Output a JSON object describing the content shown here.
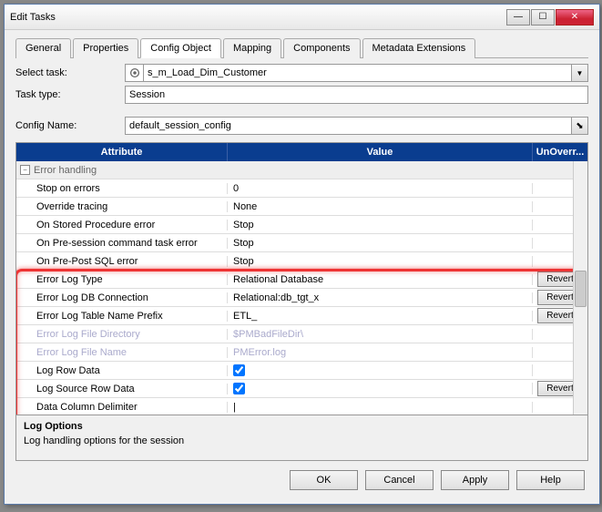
{
  "window": {
    "title": "Edit Tasks"
  },
  "tabs": [
    "General",
    "Properties",
    "Config Object",
    "Mapping",
    "Components",
    "Metadata Extensions"
  ],
  "activeTab": 2,
  "form": {
    "selectTaskLabel": "Select task:",
    "selectTaskValue": "s_m_Load_Dim_Customer",
    "taskTypeLabel": "Task type:",
    "taskTypeValue": "Session",
    "configNameLabel": "Config Name:",
    "configNameValue": "default_session_config"
  },
  "grid": {
    "headers": {
      "attr": "Attribute",
      "val": "Value",
      "unov": "UnOverr..."
    },
    "groupLabel": "Error handling",
    "rows": [
      {
        "attr": "Stop on errors",
        "val": "0",
        "type": "text"
      },
      {
        "attr": "Override tracing",
        "val": "None",
        "type": "text"
      },
      {
        "attr": "On Stored Procedure error",
        "val": "Stop",
        "type": "text"
      },
      {
        "attr": "On Pre-session command task error",
        "val": "Stop",
        "type": "text"
      },
      {
        "attr": "On Pre-Post SQL error",
        "val": "Stop",
        "type": "text"
      },
      {
        "attr": "Error Log Type",
        "val": "Relational Database",
        "type": "text",
        "revert": true,
        "hl": true
      },
      {
        "attr": "Error Log DB Connection",
        "val": "Relational:db_tgt_x",
        "type": "text",
        "revert": true,
        "hl": true
      },
      {
        "attr": "Error Log Table Name Prefix",
        "val": "ETL_",
        "type": "text",
        "revert": true,
        "hl": true
      },
      {
        "attr": "Error Log File Directory",
        "val": "$PMBadFileDir\\",
        "type": "text",
        "disabled": true,
        "hl": true
      },
      {
        "attr": "Error Log File Name",
        "val": "PMError.log",
        "type": "text",
        "disabled": true,
        "hl": true
      },
      {
        "attr": "Log Row Data",
        "val": "",
        "type": "check",
        "checked": true,
        "hl": true
      },
      {
        "attr": "Log Source Row Data",
        "val": "",
        "type": "check",
        "checked": true,
        "revert": true,
        "hl": true
      },
      {
        "attr": "Data Column Delimiter",
        "val": "|",
        "type": "text",
        "hl": true
      }
    ],
    "revertLabel": "Revert"
  },
  "bottomPane": {
    "title": "Log Options",
    "desc": "Log handling options for the session"
  },
  "buttons": {
    "ok": "OK",
    "cancel": "Cancel",
    "apply": "Apply",
    "help": "Help"
  }
}
